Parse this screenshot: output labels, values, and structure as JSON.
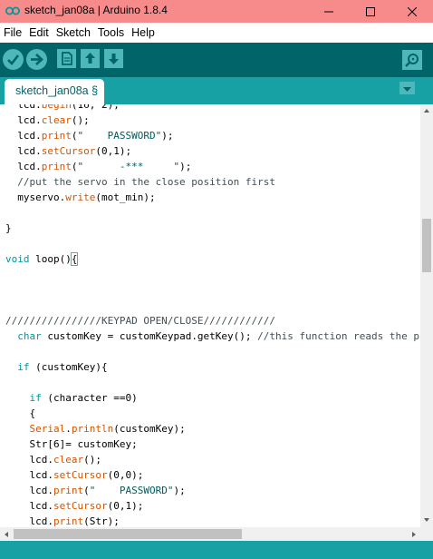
{
  "window": {
    "title": "sketch_jan08a | Arduino 1.8.4",
    "minimize_icon": "minimize-icon",
    "maximize_icon": "maximize-icon",
    "close_icon": "close-icon",
    "title_bar_color": "#f78b8b"
  },
  "menu": {
    "items": [
      "File",
      "Edit",
      "Sketch",
      "Tools",
      "Help"
    ]
  },
  "toolbar": {
    "buttons": [
      "verify-icon",
      "upload-icon",
      "new-icon",
      "open-icon",
      "save-icon"
    ],
    "serial_monitor_icon": "serial-monitor-icon",
    "background": "#006468",
    "button_color": "#4db7bb"
  },
  "tabs": {
    "active": "sketch_jan08a §",
    "menu_icon": "tab-menu-icon",
    "background": "#17a1a5"
  },
  "editor": {
    "lines": [
      "  lcd.begin(16, 2);",
      "  lcd.clear();",
      "  lcd.print(\"    PASSWORD\");",
      "  lcd.setCursor(0,1);",
      "  lcd.print(\"      -***     \");",
      "  //put the servo in the close position first",
      "  myservo.write(mot_min);",
      "",
      "}",
      "",
      "void loop(){",
      "",
      "",
      "",
      "////////////////KEYPAD OPEN/CLOSE////////////",
      "  char customKey = customKeypad.getKey(); //this function reads the presse",
      "",
      "  if (customKey){",
      "",
      "    if (character ==0)",
      "    {",
      "    Serial.println(customKey);",
      "    Str[6]= customKey;",
      "    lcd.clear();",
      "    lcd.setCursor(0,0);",
      "    lcd.print(\"    PASSWORD\");",
      "    lcd.setCursor(0,1);",
      "    lcd.print(Str);"
    ]
  }
}
